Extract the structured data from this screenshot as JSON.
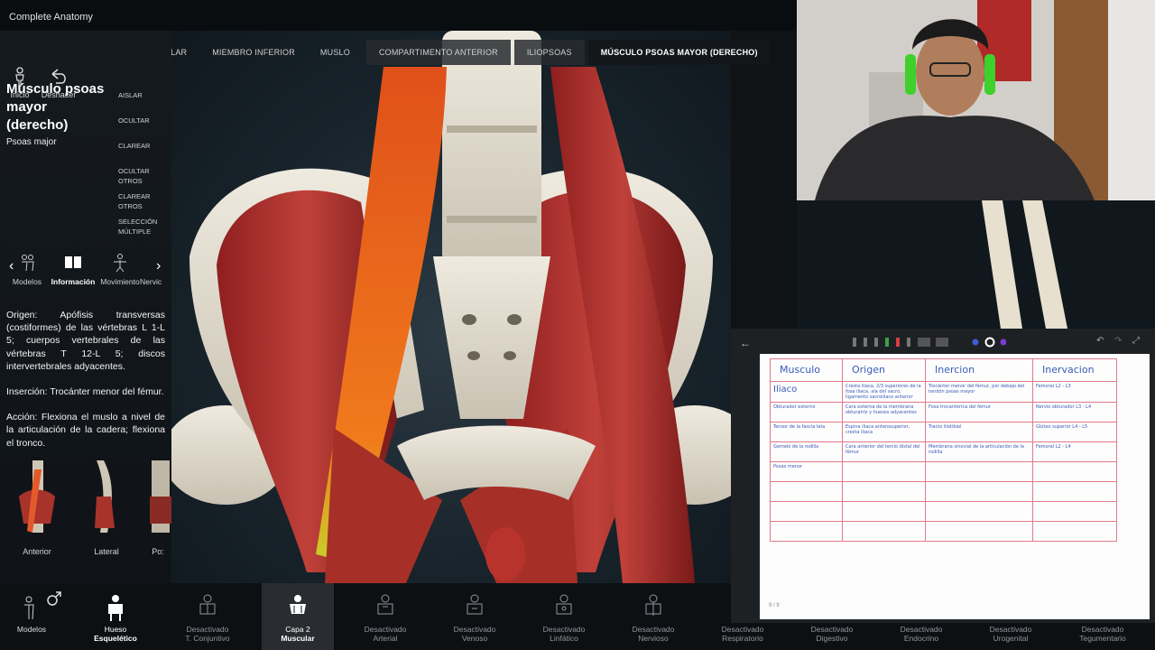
{
  "app": {
    "title": "Complete Anatomy"
  },
  "nav": {
    "home": "Inicio",
    "undo": "Deshacer"
  },
  "breadcrumb": [
    "SISTEMA MUSCULAR",
    "MIEMBRO INFERIOR",
    "MUSLO",
    "COMPARTIMENTO ANTERIOR",
    "ILIOPSOAS",
    "MÚSCULO PSOAS MAYOR (DERECHO)"
  ],
  "selection": {
    "title": "Músculo psoas mayor (derecho)",
    "latin": "Psoas major"
  },
  "actions": [
    "AISLAR",
    "OCULTAR",
    "CLAREAR",
    "OCULTAR OTROS",
    "CLAREAR OTROS",
    "SELECCIÓN MÚLTIPLE"
  ],
  "tabs": [
    "Modelos",
    "Información",
    "Movimiento",
    "Nervic"
  ],
  "info": {
    "origin": "Origen: Apófisis transversas (costiformes) de las vértebras L 1-L 5; cuerpos vertebrales de las vértebras T 12-L 5; discos intervertebrales adyacentes.",
    "insertion": "Inserción: Trocánter menor del fémur.",
    "action": "Acción: Flexiona el muslo a nivel de la articulación de la cadera; flexiona el tronco."
  },
  "views": [
    "Anterior",
    "Lateral",
    "Po:"
  ],
  "layers": [
    {
      "l1": "Modelos",
      "l2": "",
      "state": "models"
    },
    {
      "l1": "Hueso",
      "l2": "Esquelético",
      "state": "on"
    },
    {
      "l1": "Desactivado",
      "l2": "T. Conjuntivo",
      "state": "off"
    },
    {
      "l1": "Capa 2",
      "l2": "Muscular",
      "state": "selected"
    },
    {
      "l1": "Desactivado",
      "l2": "Arterial",
      "state": "off"
    },
    {
      "l1": "Desactivado",
      "l2": "Venoso",
      "state": "off"
    },
    {
      "l1": "Desactivado",
      "l2": "Linfático",
      "state": "off"
    },
    {
      "l1": "Desactivado",
      "l2": "Nervioso",
      "state": "off"
    },
    {
      "l1": "Desactivado",
      "l2": "Respiratorio",
      "state": "off"
    },
    {
      "l1": "Desactivado",
      "l2": "Digestivo",
      "state": "off"
    },
    {
      "l1": "Desactivado",
      "l2": "Endocrino",
      "state": "off"
    },
    {
      "l1": "Desactivado",
      "l2": "Urogenital",
      "state": "off"
    },
    {
      "l1": "Desactivado",
      "l2": "Tegumentario",
      "state": "off"
    }
  ],
  "notes": {
    "header": [
      "Musculo",
      "Origen",
      "Inercion",
      "Inervacion"
    ],
    "rows": [
      [
        "Iliaco",
        "Cresta iliaca, 2/3 superiores de la fosa iliaca, ala del sacro, ligamento sacroiliaco anterior",
        "Trocánter menor del fémur, por debajo del tendón psoas mayor",
        "Femoral L2 - L3"
      ],
      [
        "Obturador externo",
        "Cara externa de la membrana obturatriz y huesos adyacentes",
        "Fosa trocantérica del fémur",
        "Nervio obturador L3 - L4"
      ],
      [
        "Tensor de la fascia lata",
        "Espina iliaca anterosuperior, cresta iliaca",
        "Tracto iliotibial",
        "Glúteo superior L4 - L5"
      ],
      [
        "Gemelo de la rodilla",
        "Cara anterior del tercio distal del fémur",
        "Membrana sinovial de la articulación de la rodilla",
        "Femoral L2 - L4"
      ],
      [
        "Psoas menor",
        "",
        "",
        ""
      ],
      [
        "",
        "",
        "",
        ""
      ],
      [
        "",
        "",
        "",
        ""
      ],
      [
        "",
        "",
        "",
        ""
      ]
    ],
    "page": "9 / 9"
  }
}
